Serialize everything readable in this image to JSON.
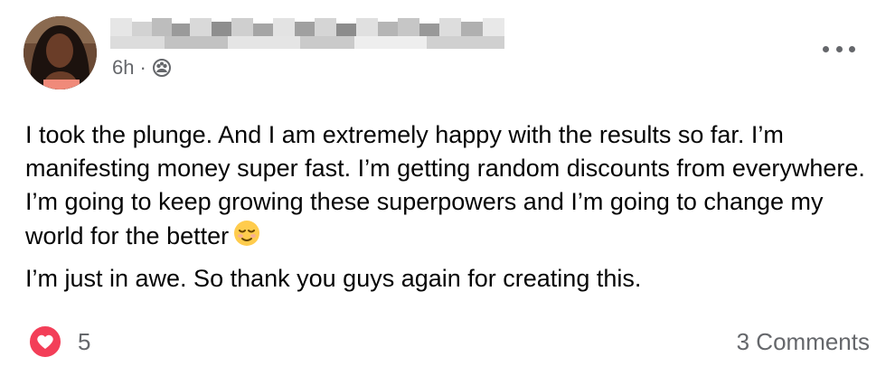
{
  "post": {
    "time": "6h",
    "separator": "·",
    "audience_icon": "friends-icon",
    "more_icon": "more-options-icon",
    "body_paragraphs": [
      "I took the plunge. And I am extremely happy with the results so far. I’m manifesting money super fast. I’m getting random discounts from everywhere. I’m going to keep growing these superpowers and I’m going to change my world for the better",
      "I’m just in awe. So thank you guys again for creating this."
    ],
    "emoji": "relieved-face-emoji"
  },
  "footer": {
    "reaction_icon": "love-reaction-icon",
    "reaction_count": "5",
    "comments_label": "3 Comments"
  },
  "colors": {
    "text_primary": "#050505",
    "text_secondary": "#65676b",
    "love_red": "#f33e58"
  }
}
